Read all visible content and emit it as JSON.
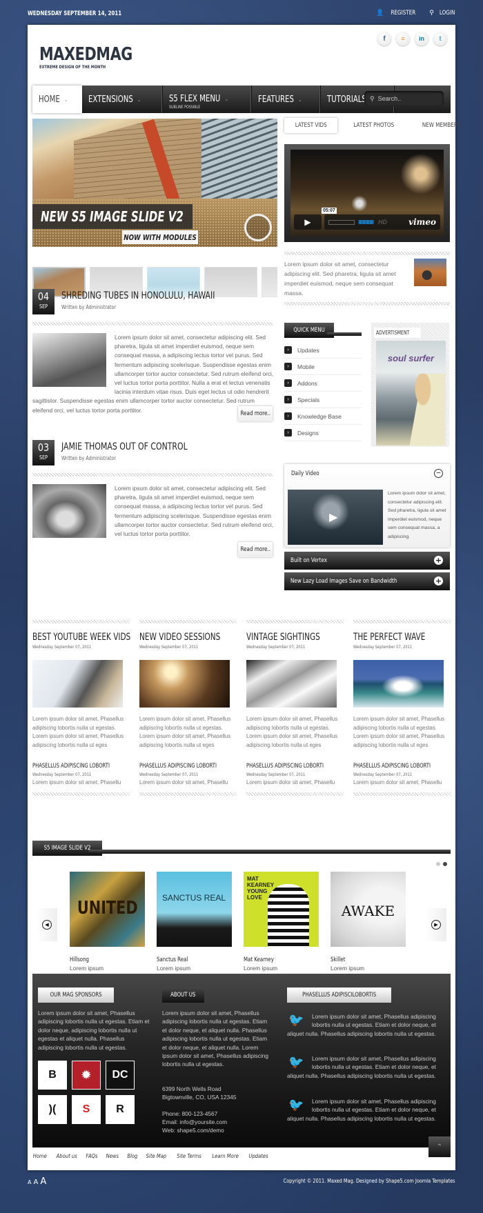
{
  "topbar": {
    "date": "WEDNESDAY SEPTEMBER 14, 2011",
    "register": "REGISTER",
    "login": "LOGIN"
  },
  "header": {
    "site_name": "MAXEDMAG",
    "tagline": "EXTREME DESIGN OF THE MONTH",
    "social": [
      {
        "icon": "facebook-icon",
        "glyph": "f",
        "color": "#3b5998"
      },
      {
        "icon": "rss-icon",
        "glyph": "௵",
        "color": "#f08a24"
      },
      {
        "icon": "linkedin-icon",
        "glyph": "in",
        "color": "#0e76a8"
      },
      {
        "icon": "twitter-icon",
        "glyph": "t",
        "color": "#4aa3df"
      }
    ]
  },
  "nav": {
    "items": [
      {
        "label": "HOME",
        "active": true
      },
      {
        "label": "EXTENSIONS"
      },
      {
        "label": "S5 FLEX MENU",
        "sub": "SUBLINE POSSIBLE"
      },
      {
        "label": "FEATURES"
      },
      {
        "label": "TUTORIALS"
      }
    ],
    "search_placeholder": "Search.."
  },
  "slideshow": {
    "caption": "NEW S5 IMAGE SLIDE V2",
    "subcaption": "NOW WITH MODULES",
    "thumb_count": 5,
    "active_thumb": 0
  },
  "tabs": {
    "items": [
      "LATEST VIDS",
      "LATEST PHOTOS",
      "NEW MEMBERS"
    ],
    "active": 0,
    "video": {
      "time": "05:07",
      "hd": "HD",
      "brand": "vimeo"
    },
    "text": "Lorem ipsum dolor sit amet, consectetur adipiscing elit. Sed pharetra, ligula sit amet imperdiet euismod, neque sem consequat massa."
  },
  "articles": [
    {
      "day": "04",
      "month": "SEP",
      "title": "SHREDING TUBES IN HONOLULU, HAWAII",
      "byline": "Written by Administrator",
      "body": "Lorem ipsum dolor sit amet, consectetur adipiscing elit. Sed pharetra, ligula sit amet imperdiet euismod, neque sem consequat massa, a adipiscing lectus tortor vel purus. Sed fermentum adipiscing scelerisque. Suspendisse egestas enim ullamcorper tortor auctor consectetur. Sed rutrum eleifend orci, vel luctus tortor porta porttitor. Nulla a erat et lectus venenatis lacinia interdum vitae risus. Duis eget lectus ut odio hendrerit sagittistor. Suspendisse egestas enim ullamcorper tortor auctor consectetur. Sed rutrum eleifend orci, vel luctus tortor porta porttitor.",
      "read_more": "Read more.."
    },
    {
      "day": "03",
      "month": "SEP",
      "title": "JAMIE THOMAS OUT OF CONTROL",
      "byline": "Written by Administrator",
      "body": "Lorem ipsum dolor sit amet, consectetur adipiscing elit. Sed pharetra, ligula sit amet imperdiet euismod, neque sem consequat massa, a adipiscing lectus tortor vel purus. Sed fermentum adipiscing scelerisque. Suspendisse egestas enim ullamcorper tortor auctor consectetur. Sed rutrum eleifend orci, vel luctus tortor porta porttitor.",
      "read_more": "Read more.."
    }
  ],
  "quick_menu": {
    "title": "QUICK MENU",
    "items": [
      "Updates",
      "Mobile",
      "Addons",
      "Specials",
      "Knowledge Base",
      "Designs"
    ]
  },
  "advert": {
    "title": "ADVERTISMENT",
    "poster_title": "soul surfer"
  },
  "daily_video": {
    "title": "Daily Video",
    "text": "Lorem ipsum dolor sit amet, consectetur adipiscing elit. Sed pharetra, ligula sit amet imperdiet euismod, neque sem consequat massa, a adipiscing."
  },
  "accordion": [
    "Built on Vertex",
    "New Lazy Load Images Save on Bandwidth"
  ],
  "columns": [
    {
      "title": "BEST YOUTUBE WEEK VIDS",
      "date": "Wednesday September 07, 2011",
      "text": "Lorem ipsum dolor sit amet, Phasellus adipiscing lobortis nulla ut egestas. Lorem ipsum dolor sit amet, Phasellus adipiscing lobortis nulla ut eges",
      "sub_title": "PHASELLUS ADIPISCING LOBORTI",
      "sub_date": "Wednesday September 07, 2011",
      "sub_text": "Lorem ipsum dolor sit amet, Phasellu"
    },
    {
      "title": "NEW VIDEO SESSIONS",
      "date": "Wednesday September 07, 2011",
      "text": "Lorem ipsum dolor sit amet, Phasellus adipiscing lobortis nulla ut egestas. Lorem ipsum dolor sit amet, Phasellus adipiscing lobortis nulla ut eges",
      "sub_title": "PHASELLUS ADIPISCING LOBORTI",
      "sub_date": "Wednesday September 07, 2011",
      "sub_text": "Lorem ipsum dolor sit amet, Phasellu"
    },
    {
      "title": "VINTAGE SIGHTINGS",
      "date": "Wednesday September 07, 2011",
      "text": "Lorem ipsum dolor sit amet, Phasellus adipiscing lobortis nulla ut egestas. Lorem ipsum dolor sit amet, Phasellus adipiscing lobortis nulla ut eges",
      "sub_title": "PHASELLUS ADIPISCING LOBORTI",
      "sub_date": "Wednesday September 07, 2011",
      "sub_text": "Lorem ipsum dolor sit amet, Phasellu"
    },
    {
      "title": "THE PERFECT WAVE",
      "date": "Wednesday September 07, 2011",
      "text": "Lorem ipsum dolor sit amet, Phasellus adipiscing lobortis nulla ut egestas. Lorem ipsum dolor sit amet, Phasellus adipiscing lobortis nulla ut eges",
      "sub_title": "PHASELLUS ADIPISCING LOBORTI",
      "sub_date": "Wednesday September 07, 2011",
      "sub_text": "Lorem ipsum dolor sit amet, Phasellu"
    }
  ],
  "image_slide": {
    "title": "S5 IMAGE SLIDE V2",
    "page_count": 2,
    "active_page": 1,
    "albums": [
      {
        "name": "Hillsong",
        "sub": "Lorem ipsum",
        "cover_text": "UNITED"
      },
      {
        "name": "Sanctus Real",
        "sub": "Lorem ipsum",
        "cover_text": "SANCTUS REAL"
      },
      {
        "name": "Mat Kearney",
        "sub": "Lorem ipsum",
        "cover_text": "MAT KEARNEY YOUNG LOVE"
      },
      {
        "name": "Skillet",
        "sub": "Lorem ipsum",
        "cover_text": "AWAKE"
      }
    ]
  },
  "footer": {
    "sponsors_title": "OUR MAG SPONSORS",
    "sponsors_text": "Lorem ipsum dolor sit amet, Phasellus adipiscing lobortis nulla ut egestas. Etiam et dolor neque, adipiscing lobortis nulla ut egestas et aliquet nulla. Phasellus adipiscing lobortis nulla ut egestas.",
    "about_title": "ABOUT US",
    "about_text": "Lorem ipsum dolor sit amet, Phasellus adipiscing lobortis nulla ut egestas. Etiam et dolor neque, et aliquet nulla. Phasellus adipiscing lobortis nulla ut egestas. Etiam et dolor neque, et aliquet nulla. Lorem ipsum dolor sit amet, Phasellus adipiscing lobortis nulla ut egestas.",
    "address1": "6399 North Wells Road",
    "address2": "Bigtownville, CO, USA 12345",
    "phone": "Phone: 800-123-4567",
    "email": "Email: info@yoursite.com",
    "web": "Web: shape5.com/demo",
    "twitter_title": "PHASELLUS ADIPISCILOBORTIS",
    "tweets": [
      "Lorem ipsum dolor sit amet, Phasellus adipiscing lobortis nulla ut egestas. Etiam et dolor neque, et aliquet nulla. Phasellus adipiscing lobortis nulla ut egestas.",
      "Lorem ipsum dolor sit amet, Phasellus adipiscing lobortis nulla ut egestas. Etiam et dolor neque, et aliquet nulla. Phasellus adipiscing lobortis nulla ut egestas.",
      "Lorem ipsum dolor sit amet, Phasellus adipiscing lobortis nulla ut egestas. Etiam et dolor neque, et aliquet nulla. Phasellus adipiscing lobortis nulla ut egestas."
    ],
    "links": [
      "Home",
      "About us",
      "FAQs",
      "News",
      "Blog",
      "Site Map",
      "Site Terms",
      "Learn More",
      "Updates"
    ]
  },
  "bottom": {
    "font_sizes": [
      "A",
      "A",
      "A"
    ],
    "copyright": "Copyright © 2011. Maxed Mag. Designed by Shape5.com Joomla Templates"
  }
}
